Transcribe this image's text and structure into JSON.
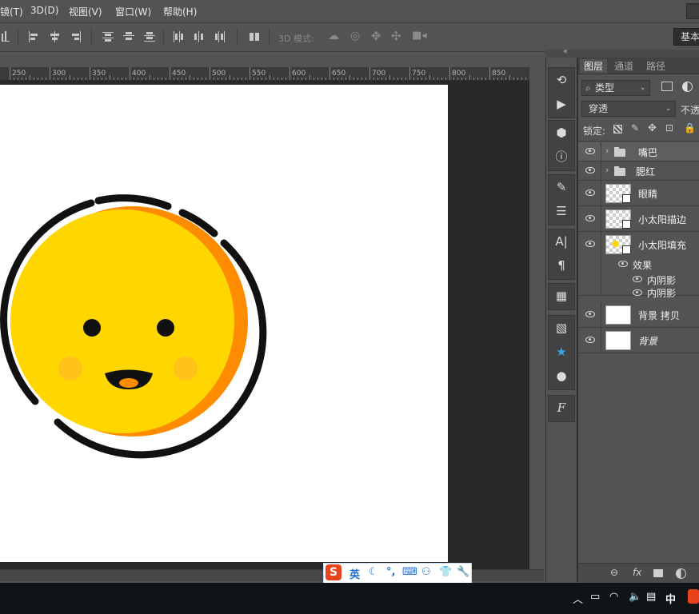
{
  "menu": {
    "items": [
      "镜(T)",
      "3D(D)",
      "视图(V)",
      "窗口(W)",
      "帮助(H)"
    ]
  },
  "options_bar": {
    "mode_3d_label": "3D 模式:",
    "workspace": "基本"
  },
  "ruler": {
    "ticks": [
      "250",
      "300",
      "350",
      "400",
      "450",
      "500",
      "550",
      "600",
      "650",
      "700",
      "750",
      "800",
      "850"
    ]
  },
  "right_toolbar": {
    "icons": [
      "history-icon",
      "play-action-icon",
      "3d-icon",
      "info-icon",
      "brushes-icon",
      "adjustments-icon",
      "character-icon",
      "paragraph-icon",
      "glyphs-icon",
      "swatches-icon",
      "star-icon",
      "user-icon",
      "font-icon"
    ],
    "character_glyph": "A|",
    "paragraph_glyph": "¶",
    "font_glyph": "F"
  },
  "layers_panel": {
    "tabs": [
      "图层",
      "通道",
      "路径"
    ],
    "active_tab": "图层",
    "filter_kind": "类型",
    "blend_mode": "穿透",
    "opacity_label": "不透",
    "lock_label": "锁定:",
    "layers": [
      {
        "name": "嘴巴",
        "type": "group",
        "selected": true
      },
      {
        "name": "腮红",
        "type": "group",
        "selected": false
      },
      {
        "name": "眼睛",
        "type": "smart",
        "selected": false
      },
      {
        "name": "小太阳描边",
        "type": "smart",
        "selected": false
      },
      {
        "name": "小太阳填充",
        "type": "smart",
        "selected": false
      },
      {
        "name": "背景 拷贝",
        "type": "white",
        "selected": false
      },
      {
        "name": "背景",
        "type": "white",
        "selected": false
      }
    ],
    "effects_label": "效果",
    "effects": [
      "内阴影",
      "内阴影"
    ],
    "bottom_icons": [
      "link-icon",
      "fx-icon",
      "mask-icon",
      "adjustment-layer-icon"
    ],
    "fx_label": "fx"
  },
  "ime_bar": {
    "logo": "S",
    "lang": "英",
    "icons": [
      "moon-icon",
      "punctuation-icon",
      "keyboard-icon",
      "user-settings-icon",
      "skin-icon",
      "tools-icon"
    ]
  },
  "taskbar": {
    "ime_indicator": "中",
    "tray_icons": [
      "chevron-up-icon",
      "battery-icon",
      "wifi-icon",
      "volume-icon",
      "notes-icon"
    ]
  },
  "colors": {
    "sun_yellow": "#FFD600",
    "sun_orange": "#FF8C00",
    "outline": "#111111",
    "blush": "#FFC21A",
    "tongue": "#FF8C00"
  }
}
